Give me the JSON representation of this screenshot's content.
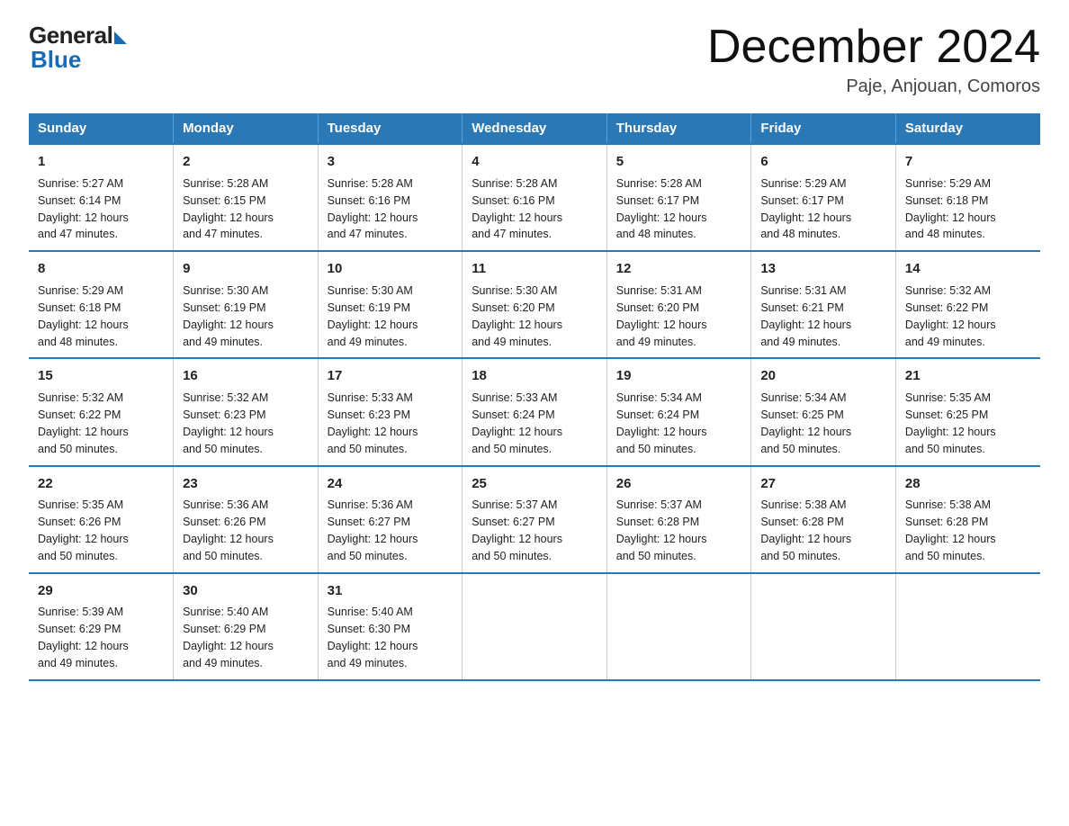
{
  "logo": {
    "general": "General",
    "blue": "Blue"
  },
  "title": "December 2024",
  "subtitle": "Paje, Anjouan, Comoros",
  "days_of_week": [
    "Sunday",
    "Monday",
    "Tuesday",
    "Wednesday",
    "Thursday",
    "Friday",
    "Saturday"
  ],
  "weeks": [
    [
      {
        "day": "1",
        "sunrise": "5:27 AM",
        "sunset": "6:14 PM",
        "daylight": "12 hours and 47 minutes."
      },
      {
        "day": "2",
        "sunrise": "5:28 AM",
        "sunset": "6:15 PM",
        "daylight": "12 hours and 47 minutes."
      },
      {
        "day": "3",
        "sunrise": "5:28 AM",
        "sunset": "6:16 PM",
        "daylight": "12 hours and 47 minutes."
      },
      {
        "day": "4",
        "sunrise": "5:28 AM",
        "sunset": "6:16 PM",
        "daylight": "12 hours and 47 minutes."
      },
      {
        "day": "5",
        "sunrise": "5:28 AM",
        "sunset": "6:17 PM",
        "daylight": "12 hours and 48 minutes."
      },
      {
        "day": "6",
        "sunrise": "5:29 AM",
        "sunset": "6:17 PM",
        "daylight": "12 hours and 48 minutes."
      },
      {
        "day": "7",
        "sunrise": "5:29 AM",
        "sunset": "6:18 PM",
        "daylight": "12 hours and 48 minutes."
      }
    ],
    [
      {
        "day": "8",
        "sunrise": "5:29 AM",
        "sunset": "6:18 PM",
        "daylight": "12 hours and 48 minutes."
      },
      {
        "day": "9",
        "sunrise": "5:30 AM",
        "sunset": "6:19 PM",
        "daylight": "12 hours and 49 minutes."
      },
      {
        "day": "10",
        "sunrise": "5:30 AM",
        "sunset": "6:19 PM",
        "daylight": "12 hours and 49 minutes."
      },
      {
        "day": "11",
        "sunrise": "5:30 AM",
        "sunset": "6:20 PM",
        "daylight": "12 hours and 49 minutes."
      },
      {
        "day": "12",
        "sunrise": "5:31 AM",
        "sunset": "6:20 PM",
        "daylight": "12 hours and 49 minutes."
      },
      {
        "day": "13",
        "sunrise": "5:31 AM",
        "sunset": "6:21 PM",
        "daylight": "12 hours and 49 minutes."
      },
      {
        "day": "14",
        "sunrise": "5:32 AM",
        "sunset": "6:22 PM",
        "daylight": "12 hours and 49 minutes."
      }
    ],
    [
      {
        "day": "15",
        "sunrise": "5:32 AM",
        "sunset": "6:22 PM",
        "daylight": "12 hours and 50 minutes."
      },
      {
        "day": "16",
        "sunrise": "5:32 AM",
        "sunset": "6:23 PM",
        "daylight": "12 hours and 50 minutes."
      },
      {
        "day": "17",
        "sunrise": "5:33 AM",
        "sunset": "6:23 PM",
        "daylight": "12 hours and 50 minutes."
      },
      {
        "day": "18",
        "sunrise": "5:33 AM",
        "sunset": "6:24 PM",
        "daylight": "12 hours and 50 minutes."
      },
      {
        "day": "19",
        "sunrise": "5:34 AM",
        "sunset": "6:24 PM",
        "daylight": "12 hours and 50 minutes."
      },
      {
        "day": "20",
        "sunrise": "5:34 AM",
        "sunset": "6:25 PM",
        "daylight": "12 hours and 50 minutes."
      },
      {
        "day": "21",
        "sunrise": "5:35 AM",
        "sunset": "6:25 PM",
        "daylight": "12 hours and 50 minutes."
      }
    ],
    [
      {
        "day": "22",
        "sunrise": "5:35 AM",
        "sunset": "6:26 PM",
        "daylight": "12 hours and 50 minutes."
      },
      {
        "day": "23",
        "sunrise": "5:36 AM",
        "sunset": "6:26 PM",
        "daylight": "12 hours and 50 minutes."
      },
      {
        "day": "24",
        "sunrise": "5:36 AM",
        "sunset": "6:27 PM",
        "daylight": "12 hours and 50 minutes."
      },
      {
        "day": "25",
        "sunrise": "5:37 AM",
        "sunset": "6:27 PM",
        "daylight": "12 hours and 50 minutes."
      },
      {
        "day": "26",
        "sunrise": "5:37 AM",
        "sunset": "6:28 PM",
        "daylight": "12 hours and 50 minutes."
      },
      {
        "day": "27",
        "sunrise": "5:38 AM",
        "sunset": "6:28 PM",
        "daylight": "12 hours and 50 minutes."
      },
      {
        "day": "28",
        "sunrise": "5:38 AM",
        "sunset": "6:28 PM",
        "daylight": "12 hours and 50 minutes."
      }
    ],
    [
      {
        "day": "29",
        "sunrise": "5:39 AM",
        "sunset": "6:29 PM",
        "daylight": "12 hours and 49 minutes."
      },
      {
        "day": "30",
        "sunrise": "5:40 AM",
        "sunset": "6:29 PM",
        "daylight": "12 hours and 49 minutes."
      },
      {
        "day": "31",
        "sunrise": "5:40 AM",
        "sunset": "6:30 PM",
        "daylight": "12 hours and 49 minutes."
      },
      null,
      null,
      null,
      null
    ]
  ],
  "labels": {
    "sunrise": "Sunrise:",
    "sunset": "Sunset:",
    "daylight": "Daylight:"
  }
}
